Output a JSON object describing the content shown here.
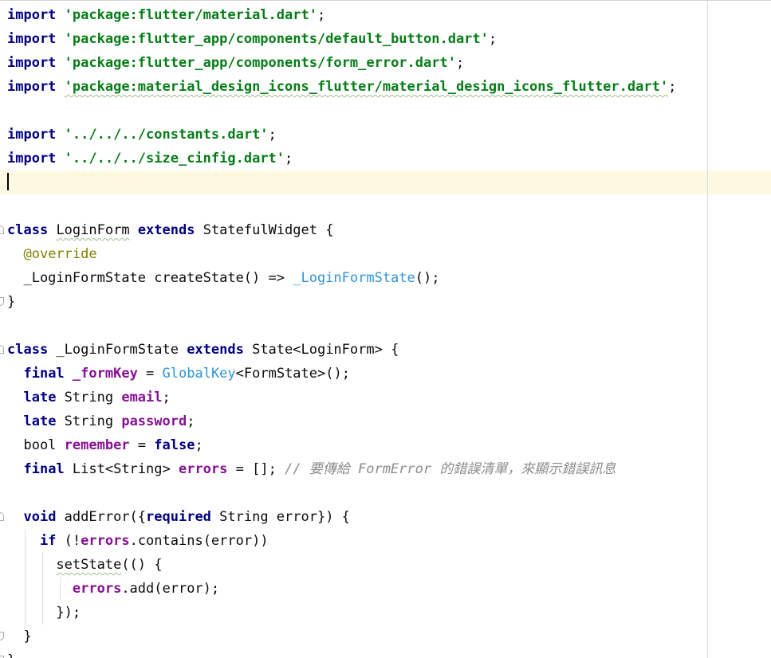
{
  "editor": {
    "language": "dart",
    "current_line": 7,
    "right_margin_visible": true,
    "lines": [
      [
        {
          "t": "import",
          "s": "kw"
        },
        {
          "t": " "
        },
        {
          "t": "'package:flutter/material.dart'",
          "s": "str"
        },
        {
          "t": ";"
        }
      ],
      [
        {
          "t": "import",
          "s": "kw"
        },
        {
          "t": " "
        },
        {
          "t": "'package:flutter_app/components/default_button.dart'",
          "s": "str"
        },
        {
          "t": ";"
        }
      ],
      [
        {
          "t": "import",
          "s": "kw"
        },
        {
          "t": " "
        },
        {
          "t": "'package:flutter_app/components/form_error.dart'",
          "s": "str"
        },
        {
          "t": ";"
        }
      ],
      [
        {
          "t": "import",
          "s": "kw"
        },
        {
          "t": " "
        },
        {
          "t": "'package:material_design_icons_flutter/material_design_icons_flutter.dart'",
          "s": "str",
          "w": true
        },
        {
          "t": ";"
        }
      ],
      [],
      [
        {
          "t": "import",
          "s": "kw"
        },
        {
          "t": " "
        },
        {
          "t": "'../../../constants.dart'",
          "s": "str"
        },
        {
          "t": ";"
        }
      ],
      [
        {
          "t": "import",
          "s": "kw"
        },
        {
          "t": " "
        },
        {
          "t": "'../../../size_cinfig.dart'",
          "s": "str"
        },
        {
          "t": ";"
        }
      ],
      [],
      [],
      [
        {
          "t": "class",
          "s": "kw"
        },
        {
          "t": " "
        },
        {
          "t": "LoginForm",
          "w": true
        },
        {
          "t": " "
        },
        {
          "t": "extends",
          "s": "kw"
        },
        {
          "t": " StatefulWidget {"
        }
      ],
      [
        {
          "t": "  "
        },
        {
          "t": "@override",
          "s": "ann"
        }
      ],
      [
        {
          "t": "  _LoginFormState createState() => "
        },
        {
          "t": "_LoginFormState",
          "s": "blu"
        },
        {
          "t": "();"
        }
      ],
      [
        {
          "t": "}"
        }
      ],
      [],
      [
        {
          "t": "class",
          "s": "kw"
        },
        {
          "t": " _LoginFormState "
        },
        {
          "t": "extends",
          "s": "kw"
        },
        {
          "t": " State<LoginForm> {"
        }
      ],
      [
        {
          "t": "  "
        },
        {
          "t": "final",
          "s": "kw"
        },
        {
          "t": " "
        },
        {
          "t": "_formKey",
          "s": "fld"
        },
        {
          "t": " = "
        },
        {
          "t": "GlobalKey",
          "s": "blu"
        },
        {
          "t": "<FormState>();"
        }
      ],
      [
        {
          "t": "  "
        },
        {
          "t": "late",
          "s": "kw"
        },
        {
          "t": " String "
        },
        {
          "t": "email",
          "s": "fld"
        },
        {
          "t": ";"
        }
      ],
      [
        {
          "t": "  "
        },
        {
          "t": "late",
          "s": "kw"
        },
        {
          "t": " String "
        },
        {
          "t": "password",
          "s": "fld"
        },
        {
          "t": ";"
        }
      ],
      [
        {
          "t": "  bool "
        },
        {
          "t": "remember",
          "s": "fld"
        },
        {
          "t": " = "
        },
        {
          "t": "false",
          "s": "kw"
        },
        {
          "t": ";"
        }
      ],
      [
        {
          "t": "  "
        },
        {
          "t": "final",
          "s": "kw"
        },
        {
          "t": " List<String> "
        },
        {
          "t": "errors",
          "s": "fld"
        },
        {
          "t": " = []; "
        },
        {
          "t": "// 要傳給 FormError 的錯誤清單，來顯示錯誤訊息",
          "s": "cmt"
        }
      ],
      [],
      [
        {
          "t": "  "
        },
        {
          "t": "void",
          "s": "kw"
        },
        {
          "t": " addError({"
        },
        {
          "t": "required",
          "s": "kw"
        },
        {
          "t": " String error}) {"
        }
      ],
      [
        {
          "t": "    "
        },
        {
          "t": "if",
          "s": "kw"
        },
        {
          "t": " (!"
        },
        {
          "t": "errors",
          "s": "fld"
        },
        {
          "t": ".contains(error))"
        }
      ],
      [
        {
          "t": "      "
        },
        {
          "t": "setState",
          "w": true
        },
        {
          "t": "(() {"
        }
      ],
      [
        {
          "t": "        "
        },
        {
          "t": "errors",
          "s": "fld"
        },
        {
          "t": ".add(error);"
        }
      ],
      [
        {
          "t": "      });"
        }
      ],
      [
        {
          "t": "  }"
        }
      ],
      [
        {
          "t": "}"
        }
      ]
    ]
  }
}
